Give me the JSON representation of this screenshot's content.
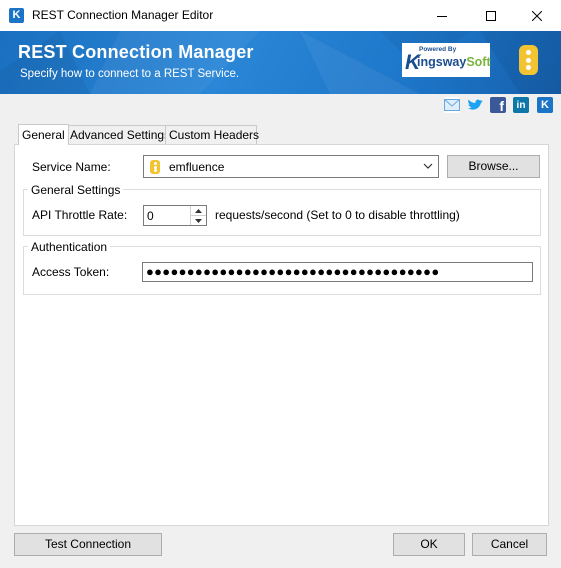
{
  "window": {
    "title": "REST Connection Manager Editor",
    "app_icon_letter": "K"
  },
  "header": {
    "title": "REST Connection Manager",
    "subtitle": "Specify how to connect to a REST Service.",
    "brand_powered": "Powered By",
    "brand_k": "K",
    "brand_name_main": "ingsway",
    "brand_name_soft": "Soft"
  },
  "social": [
    {
      "name": "email-icon",
      "glyph": "✉",
      "color": "#6aa7dc"
    },
    {
      "name": "twitter-icon",
      "glyph": "•",
      "color": "#1da1f2"
    },
    {
      "name": "facebook-icon",
      "glyph": "f",
      "color": "#3b5998"
    },
    {
      "name": "linkedin-icon",
      "glyph": "in",
      "color": "#0e76a8"
    },
    {
      "name": "kingswaysoft-icon",
      "glyph": "K",
      "color": "#1b74c5"
    }
  ],
  "tabs": [
    {
      "label": "General",
      "active": true
    },
    {
      "label": "Advanced Settings",
      "active": false
    },
    {
      "label": "Custom Headers",
      "active": false
    }
  ],
  "general": {
    "service_name_label": "Service Name:",
    "service_name_value": "emfluence",
    "browse_label": "Browse...",
    "settings_group_title": "General Settings",
    "throttle_label": "API Throttle Rate:",
    "throttle_value": "0",
    "throttle_hint": "requests/second (Set to 0 to disable throttling)",
    "auth_group_title": "Authentication",
    "access_token_label": "Access Token:",
    "access_token_value": "●●●●●●●●●●●●●●●●●●●●●●●●●●●●●●●●●●●●"
  },
  "footer": {
    "test_connection_label": "Test Connection",
    "ok_label": "OK",
    "cancel_label": "Cancel"
  },
  "colors": {
    "header_blue": "#1e78cb",
    "logo_yellow": "#f3c431",
    "brand_green": "#7cb33b"
  }
}
